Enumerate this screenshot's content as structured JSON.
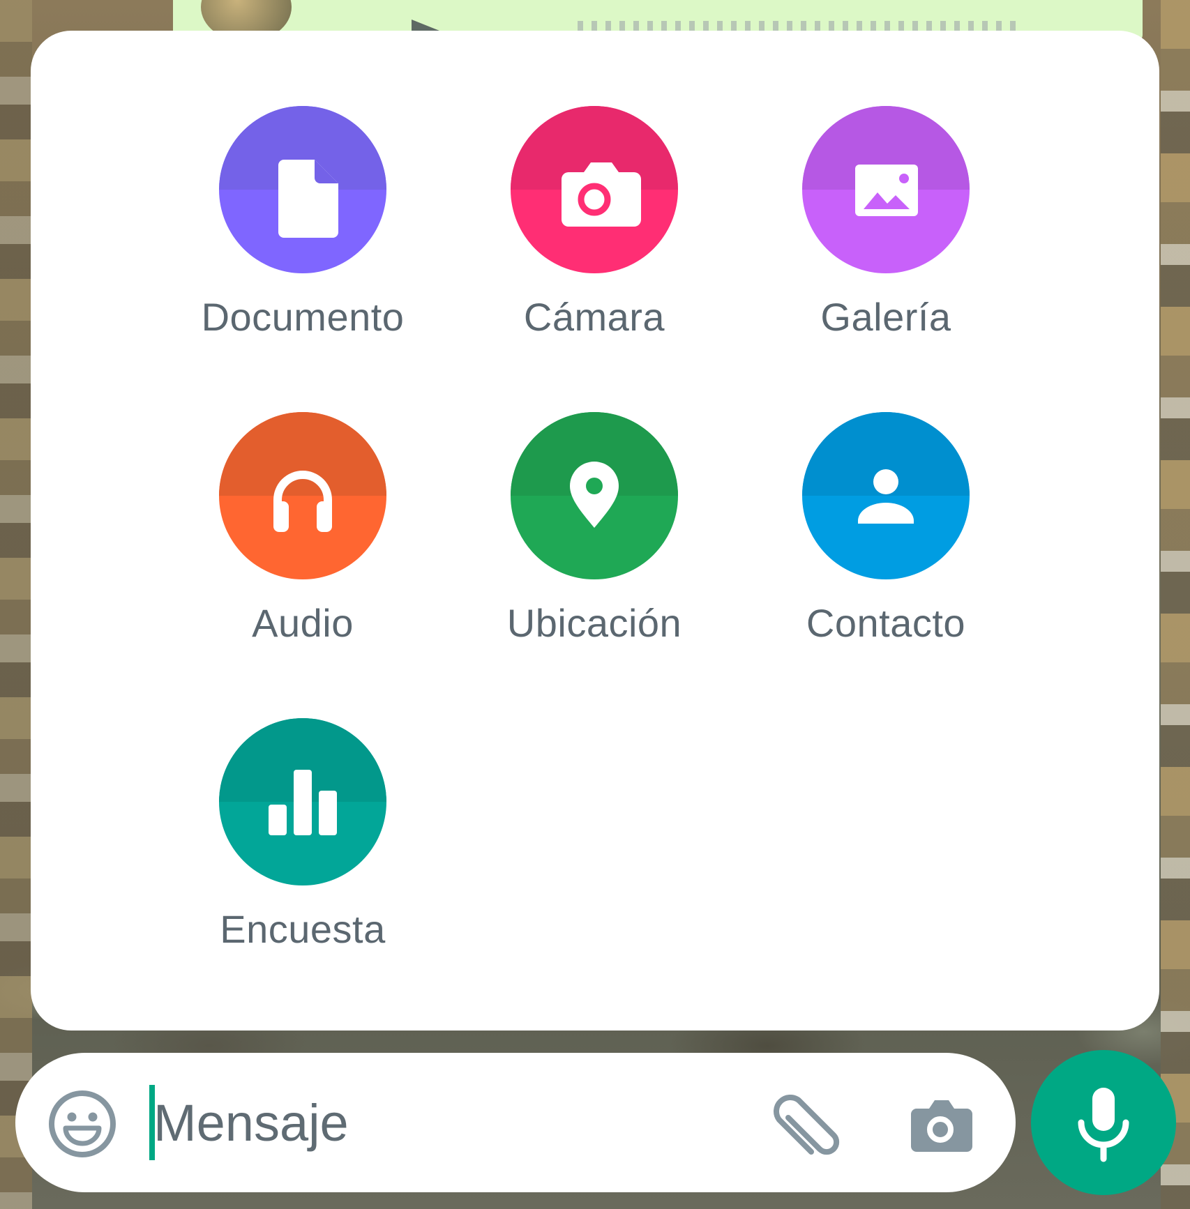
{
  "attach_menu": {
    "options": [
      {
        "label": "Documento",
        "icon": "document-icon",
        "color": "#7f66ff"
      },
      {
        "label": "Cámara",
        "icon": "camera-icon",
        "color": "#ff2e74"
      },
      {
        "label": "Galería",
        "icon": "gallery-icon",
        "color": "#c861fa"
      },
      {
        "label": "Audio",
        "icon": "headphones-icon",
        "color": "#ff6631"
      },
      {
        "label": "Ubicación",
        "icon": "location-pin-icon",
        "color": "#1fa855"
      },
      {
        "label": "Contacto",
        "icon": "contact-person-icon",
        "color": "#009de2"
      },
      {
        "label": "Encuesta",
        "icon": "poll-chart-icon",
        "color": "#02a698"
      }
    ]
  },
  "composer": {
    "placeholder": "Mensaje",
    "accent_color": "#00a884",
    "icons": [
      "emoji-icon",
      "paperclip-icon",
      "camera-icon",
      "microphone-icon"
    ]
  }
}
